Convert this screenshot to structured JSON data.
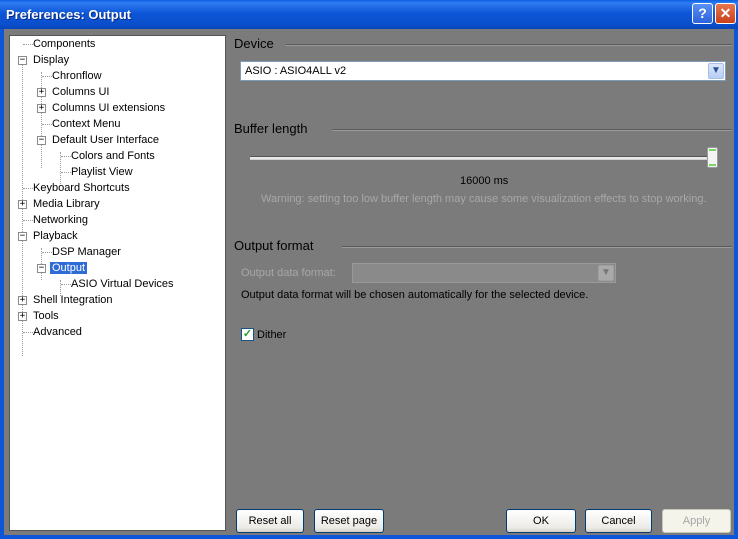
{
  "window": {
    "title": "Preferences: Output",
    "help_glyph": "?",
    "close_glyph": "✕"
  },
  "tree": {
    "components": "Components",
    "display": "Display",
    "chronflow": "Chronflow",
    "columns_ui": "Columns UI",
    "columns_ui_ext": "Columns UI extensions",
    "context_menu": "Context Menu",
    "default_ui": "Default User Interface",
    "colors_fonts": "Colors and Fonts",
    "playlist_view": "Playlist View",
    "keyboard_shortcuts": "Keyboard Shortcuts",
    "media_library": "Media Library",
    "networking": "Networking",
    "playback": "Playback",
    "dsp_manager": "DSP Manager",
    "output": "Output",
    "asio_virtual": "ASIO Virtual Devices",
    "shell_integration": "Shell Integration",
    "tools": "Tools",
    "advanced": "Advanced",
    "expand_plus": "+",
    "expand_minus": "−"
  },
  "device": {
    "heading": "Device",
    "value": "ASIO : ASIO4ALL v2"
  },
  "buffer": {
    "heading": "Buffer length",
    "value_text": "16000 ms",
    "slider_fraction": 1.0,
    "warning": "Warning: setting too low buffer length may cause some visualization effects to stop working."
  },
  "output_format": {
    "heading": "Output format",
    "data_format_label": "Output data format:",
    "note": "Output data format will be chosen automatically for the selected device."
  },
  "dither": {
    "label": "Dither",
    "checked": true,
    "check_glyph": "✓"
  },
  "buttons": {
    "reset_all": "Reset all",
    "reset_page": "Reset page",
    "ok": "OK",
    "cancel": "Cancel",
    "apply": "Apply"
  },
  "colors": {
    "titlebar": "#0d56d8",
    "panel_bg": "#7b7b7b",
    "selection": "#2e6bd6"
  }
}
